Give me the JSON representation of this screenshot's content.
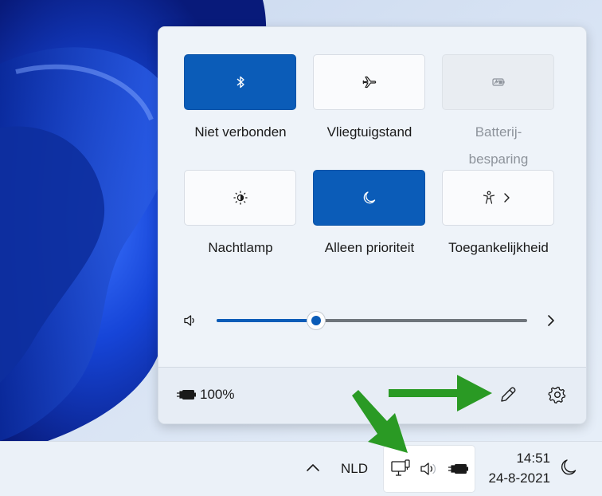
{
  "quick_settings": {
    "tiles": [
      {
        "label": "Niet verbonden",
        "icon": "bluetooth-icon",
        "state": "on"
      },
      {
        "label": "Vliegtuigstand",
        "icon": "airplane-icon",
        "state": "off"
      },
      {
        "label": "Batterij-\nbesparing",
        "icon": "battery-saver-icon",
        "state": "disabled"
      },
      {
        "label": "Nachtlamp",
        "icon": "brightness-icon",
        "state": "off"
      },
      {
        "label": "Alleen prioriteit",
        "icon": "moon-icon",
        "state": "on"
      },
      {
        "label": "Toegankelijkheid",
        "icon": "accessibility-icon",
        "state": "off",
        "has_submenu": true
      }
    ],
    "volume": {
      "icon": "speaker-icon",
      "level": 0.32,
      "more_icon": "chevron-right-icon"
    },
    "footer": {
      "battery_icon": "battery-charging-icon",
      "battery_text": "100%",
      "edit_icon": "pencil-icon",
      "settings_icon": "gear-icon"
    }
  },
  "taskbar": {
    "overflow_icon": "chevron-up-icon",
    "language": "NLD",
    "tray_icons": [
      "network-icon",
      "volume-icon",
      "battery-icon"
    ],
    "time": "14:51",
    "date": "24-8-2021",
    "focus_icon": "moon-icon"
  },
  "colors": {
    "accent": "#0b5cb8",
    "annotation_arrow": "#2a9a24"
  }
}
